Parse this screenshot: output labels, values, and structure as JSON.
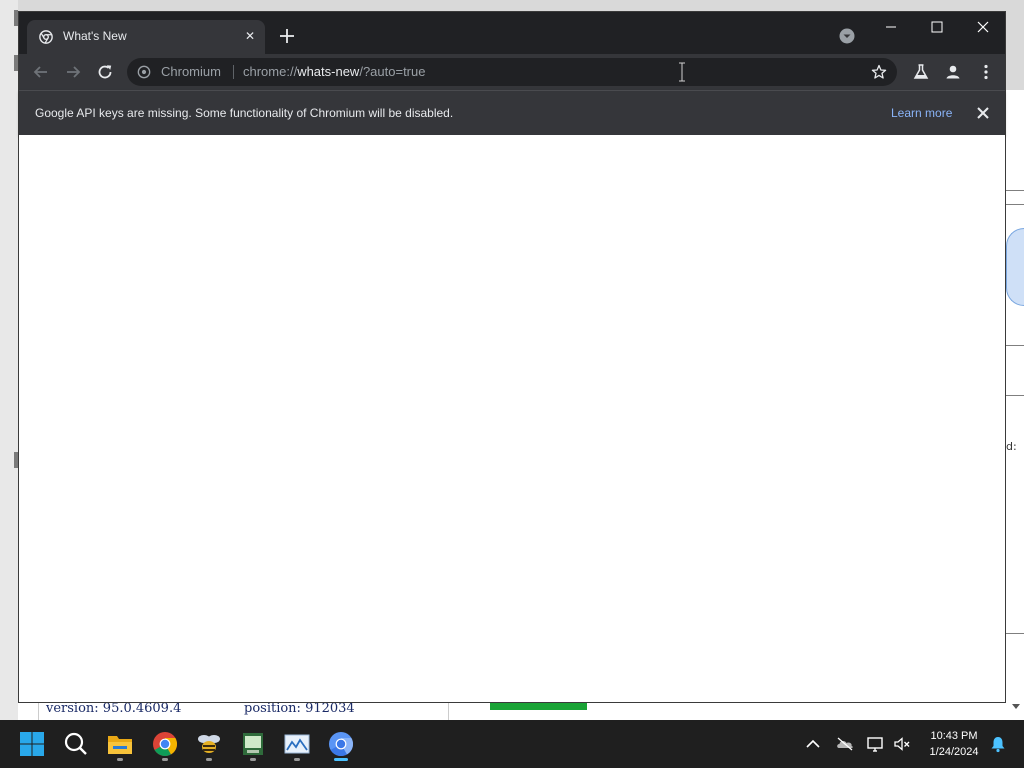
{
  "browser": {
    "tab": {
      "title": "What's New"
    },
    "omnibox": {
      "site_name": "Chromium",
      "url_scheme": "chrome://",
      "url_host": "whats-new",
      "url_path": "/?auto=true"
    },
    "infobar": {
      "message": "Google API keys are missing. Some functionality of Chromium will be disabled.",
      "link": "Learn more"
    }
  },
  "background_window": {
    "version_text": "version: 95.0.4609.4",
    "position_text": "position: 912034",
    "edge_text": "d:"
  },
  "taskbar": {
    "apps": [
      "start-button",
      "search",
      "file-explorer",
      "chrome",
      "bee-app",
      "terminal-app",
      "photos-app",
      "chromium"
    ],
    "active_app": "chromium",
    "clock": {
      "time": "10:43 PM",
      "date": "1/24/2024"
    }
  },
  "colors": {
    "tabstrip": "#202124",
    "toolbar": "#35363a",
    "link": "#8ab4f8",
    "taskbar": "#1f1f1f",
    "active_indicator": "#4cc2ff"
  }
}
